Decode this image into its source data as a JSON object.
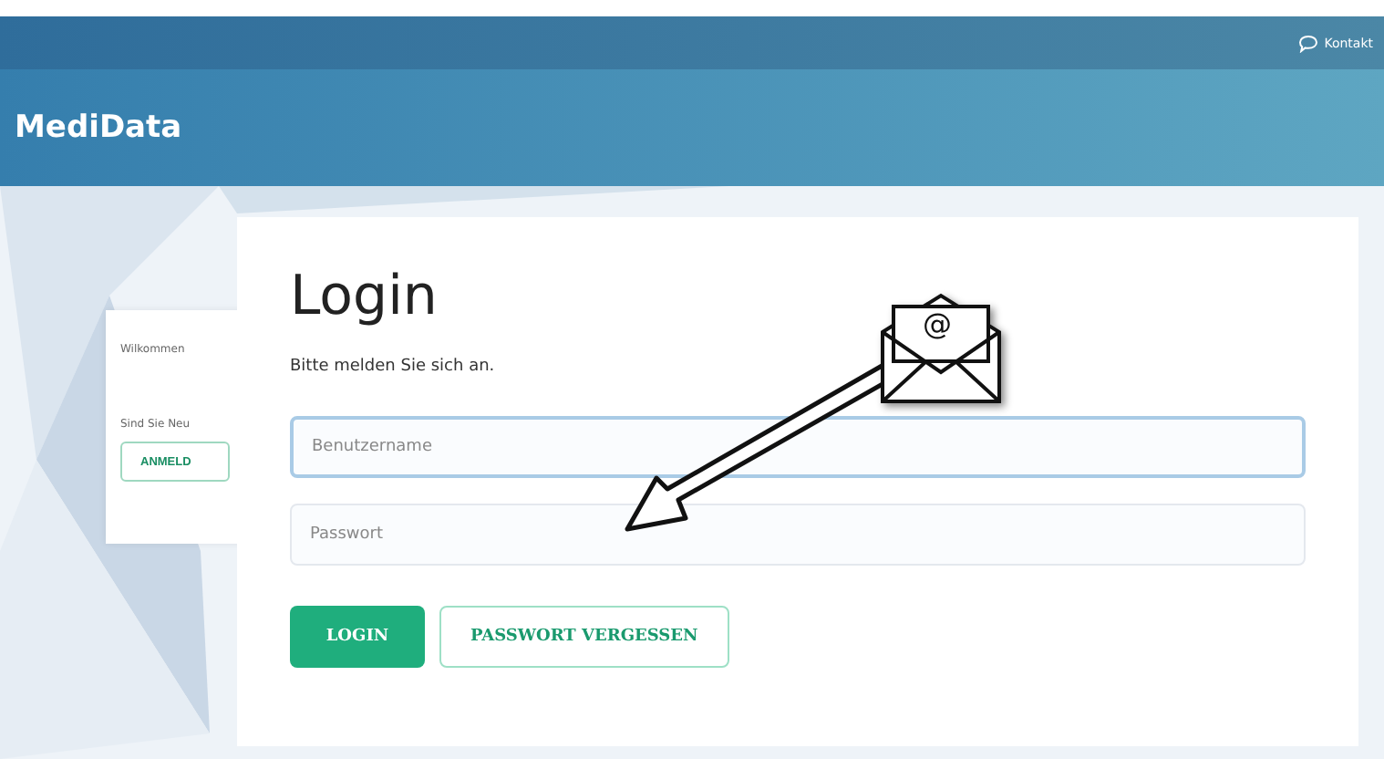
{
  "topbar": {
    "contact_link": "Kontakt"
  },
  "header": {
    "logo": "MediData"
  },
  "side_card": {
    "welcome": "Wilkommen",
    "question": "Sind Sie Neu",
    "register_button": "ANMELD"
  },
  "login_card": {
    "title": "Login",
    "subtitle": "Bitte melden Sie sich an.",
    "fields": [
      {
        "placeholder": "Benutzername",
        "focused": true
      },
      {
        "placeholder": "Passwort",
        "focused": false
      }
    ],
    "buttons": [
      {
        "label": "LOGIN",
        "kind": "primary"
      },
      {
        "label": "PASSWORT VERGESSEN",
        "kind": "outline"
      }
    ]
  },
  "overlay": {
    "envelope_symbol": "@"
  }
}
